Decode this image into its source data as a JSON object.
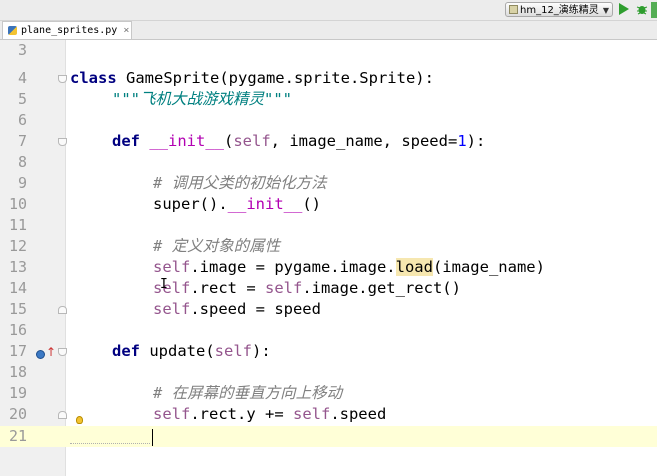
{
  "toolbar": {
    "run_config": "hm_12_演练精灵",
    "run_icon": "run-play-icon",
    "debug_icon": "debug-bug-icon"
  },
  "tabs": [
    {
      "label": "plane_sprites.py",
      "close": "×",
      "icon": "python-file-icon",
      "active": true
    }
  ],
  "editor": {
    "line_numbers": [
      "3",
      "4",
      "5",
      "6",
      "7",
      "8",
      "9",
      "10",
      "11",
      "12",
      "13",
      "14",
      "15",
      "16",
      "17",
      "18",
      "19",
      "20",
      "21"
    ],
    "current_line": "21",
    "colors": {
      "keyword": "#000080",
      "self": "#94558d",
      "number": "#0000ff",
      "docstring": "#008080",
      "comment": "#808080",
      "magic": "#b200b2",
      "current_line_bg": "#ffffd7",
      "gutter_bg": "#f0f0f0"
    },
    "code": {
      "l4": {
        "kw": "class",
        "rest": " GameSprite(pygame.sprite.Sprite):"
      },
      "l5": {
        "doc": "\"\"\"飞机大战游戏精灵\"\"\""
      },
      "l7": {
        "kw": "def",
        "sp": " ",
        "magic": "__init__",
        "open": "(",
        "self": "self",
        "rest": ", image_name, speed=",
        "num": "1",
        "close": "):"
      },
      "l9": {
        "comment": "# 调用父类的初始化方法"
      },
      "l10": {
        "pre": "super().",
        "magic": "__init__",
        "post": "()"
      },
      "l12": {
        "comment": "# 定义对象的属性"
      },
      "l13": {
        "self": "self",
        "mid": ".image = pygame.image.",
        "hl": "load",
        "post": "(image_name)"
      },
      "l14": {
        "self1": "self",
        "mid": ".rect = ",
        "self2": "self",
        "post": ".image.get_rect()"
      },
      "l15": {
        "self": "self",
        "post": ".speed = speed"
      },
      "l17": {
        "kw": "def",
        "mid": " update(",
        "self": "self",
        "post": "):"
      },
      "l19": {
        "comment": "# 在屏幕的垂直方向上移动"
      },
      "l20": {
        "self1": "self",
        "mid": ".rect.y += ",
        "self2": "self",
        "post": ".speed"
      }
    }
  }
}
